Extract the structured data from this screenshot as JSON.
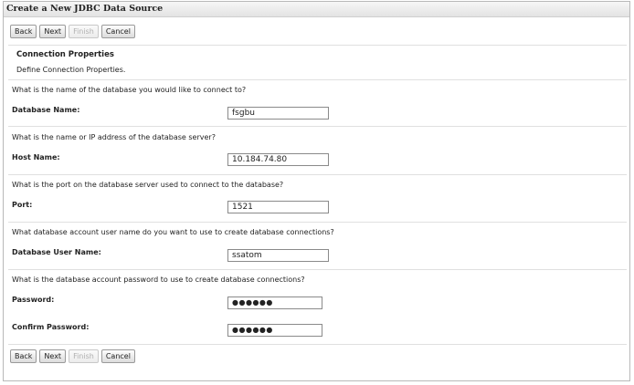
{
  "window": {
    "title": "Create a New JDBC Data Source"
  },
  "buttons": {
    "back": "Back",
    "next": "Next",
    "finish": "Finish",
    "cancel": "Cancel"
  },
  "section": {
    "title": "Connection Properties",
    "description": "Define Connection Properties."
  },
  "fields": {
    "database_name": {
      "question": "What is the name of the database you would like to connect to?",
      "label": "Database Name:",
      "value": "fsgbu"
    },
    "host_name": {
      "question": "What is the name or IP address of the database server?",
      "label": "Host Name:",
      "value": "10.184.74.80"
    },
    "port": {
      "question": "What is the port on the database server used to connect to the database?",
      "label": "Port:",
      "value": "1521"
    },
    "db_user": {
      "question": "What database account user name do you want to use to create database connections?",
      "label": "Database User Name:",
      "value": "ssatom"
    },
    "password": {
      "question": "What is the database account password to use to create database connections?",
      "label": "Password:",
      "value": "●●●●●●"
    },
    "confirm_password": {
      "label": "Confirm Password:",
      "value": "●●●●●●"
    }
  }
}
